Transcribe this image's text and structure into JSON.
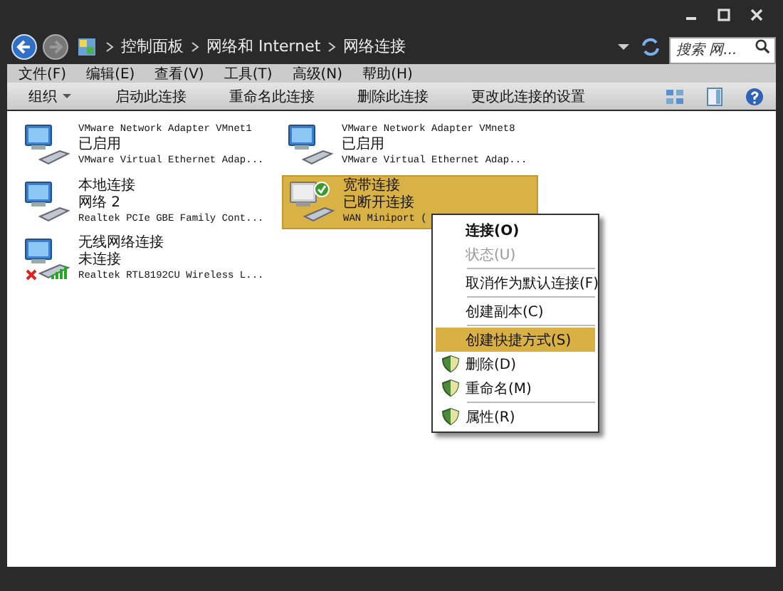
{
  "window": {
    "breadcrumb": [
      "控制面板",
      "网络和 Internet",
      "网络连接"
    ],
    "search": {
      "placeholder": "搜索 网..."
    }
  },
  "menu_bar": [
    "文件(F)",
    "编辑(E)",
    "查看(V)",
    "工具(T)",
    "高级(N)",
    "帮助(H)"
  ],
  "toolbar": [
    {
      "label": "组织",
      "dropdown": true
    },
    {
      "label": "启动此连接",
      "dropdown": false
    },
    {
      "label": "重命名此连接",
      "dropdown": false
    },
    {
      "label": "删除此连接",
      "dropdown": false
    },
    {
      "label": "更改此连接的设置",
      "dropdown": false
    }
  ],
  "connections": [
    {
      "name": "VMware Network Adapter VMnet1",
      "status": "已启用",
      "device": "VMware Virtual Ethernet Adap...",
      "kind": "lan",
      "default": false,
      "error": false,
      "selected": false
    },
    {
      "name": "VMware Network Adapter VMnet8",
      "status": "已启用",
      "device": "VMware Virtual Ethernet Adap...",
      "kind": "lan",
      "default": false,
      "error": false,
      "selected": false
    },
    {
      "name": "本地连接",
      "status": "网络  2",
      "device": "Realtek PCIe GBE Family Cont...",
      "kind": "lan",
      "default": false,
      "error": false,
      "selected": false
    },
    {
      "name": "宽带连接",
      "status": "已断开连接",
      "device": "WAN Miniport (",
      "kind": "broadband",
      "default": true,
      "error": false,
      "selected": true
    },
    {
      "name": "无线网络连接",
      "status": "未连接",
      "device": "Realtek RTL8192CU Wireless L...",
      "kind": "wireless",
      "default": false,
      "error": true,
      "selected": false
    }
  ],
  "context_menu": [
    {
      "label": "连接(O)",
      "default": true,
      "disabled": false,
      "selected": false,
      "shield": false,
      "separator_before": false
    },
    {
      "label": "状态(U)",
      "default": false,
      "disabled": true,
      "selected": false,
      "shield": false,
      "separator_before": false
    },
    {
      "label": "取消作为默认连接(F)",
      "default": false,
      "disabled": false,
      "selected": false,
      "shield": false,
      "separator_before": true
    },
    {
      "label": "创建副本(C)",
      "default": false,
      "disabled": false,
      "selected": false,
      "shield": false,
      "separator_before": true
    },
    {
      "label": "创建快捷方式(S)",
      "default": false,
      "disabled": false,
      "selected": true,
      "shield": false,
      "separator_before": true
    },
    {
      "label": "删除(D)",
      "default": false,
      "disabled": false,
      "selected": false,
      "shield": true,
      "separator_before": false
    },
    {
      "label": "重命名(M)",
      "default": false,
      "disabled": false,
      "selected": false,
      "shield": true,
      "separator_before": false
    },
    {
      "label": "属性(R)",
      "default": false,
      "disabled": false,
      "selected": false,
      "shield": true,
      "separator_before": true
    }
  ]
}
